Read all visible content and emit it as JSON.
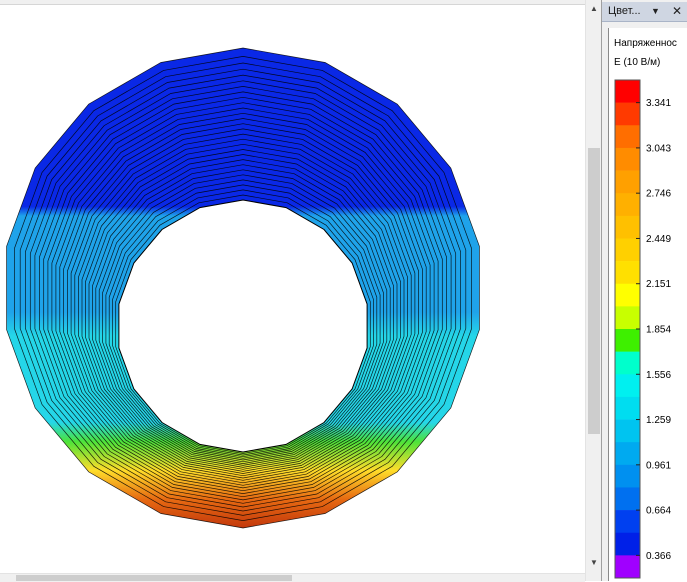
{
  "panel": {
    "title": "Цвет...",
    "dropdown_glyph": "▼",
    "close_glyph": "✕"
  },
  "legend": {
    "title": "Напряженнос",
    "unit": "E (10 В/м)",
    "tick_labels": [
      "3.341",
      "3.043",
      "2.746",
      "2.449",
      "2.151",
      "1.854",
      "1.556",
      "1.259",
      "0.961",
      "0.664",
      "0.366"
    ],
    "colors": [
      "#ff0000",
      "#ff3a00",
      "#ff6e00",
      "#ff8c00",
      "#ffa000",
      "#ffb000",
      "#ffc000",
      "#ffd000",
      "#ffe000",
      "#ffff00",
      "#c8ff00",
      "#3ef000",
      "#00ffcc",
      "#00f0f0",
      "#00ddf0",
      "#00c4f0",
      "#00aaf0",
      "#0090f0",
      "#0070f0",
      "#0040f0",
      "#0020e8",
      "#a000ff"
    ]
  },
  "plot": {
    "colors": {
      "outer": "#0a28e6",
      "mid": "#1fa3ea",
      "inner": "#25d6e8",
      "green": "#4de33a",
      "yellow": "#ffdd2a",
      "orange": "#e76a12",
      "deep": "#c3380c"
    }
  }
}
